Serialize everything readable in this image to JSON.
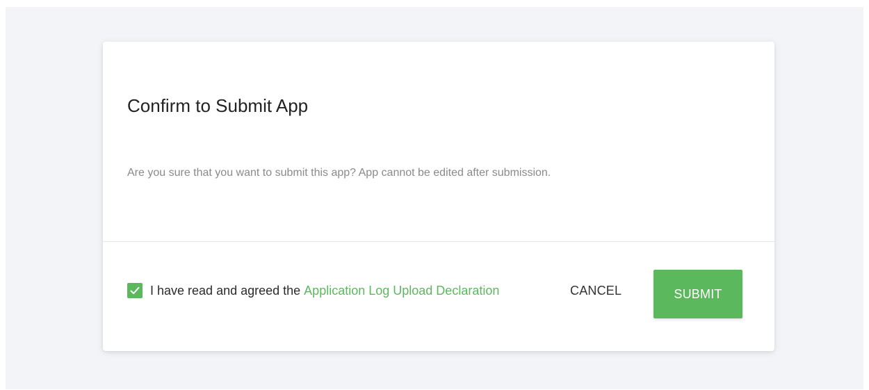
{
  "colors": {
    "accent": "#5cb85c",
    "backdrop": "#f2f4f7",
    "title_text": "#222222",
    "muted_text": "#8a8a8a"
  },
  "dialog": {
    "title": "Confirm to Submit App",
    "message": "Are you sure that you want to submit this app? App cannot be edited after submission.",
    "agreement": {
      "checked": true,
      "checkbox_icon": "check-icon",
      "prefix": "I have read and agreed the",
      "link_label": "Application Log Upload Declaration"
    },
    "actions": {
      "cancel_label": "CANCEL",
      "submit_label": "SUBMIT"
    }
  }
}
